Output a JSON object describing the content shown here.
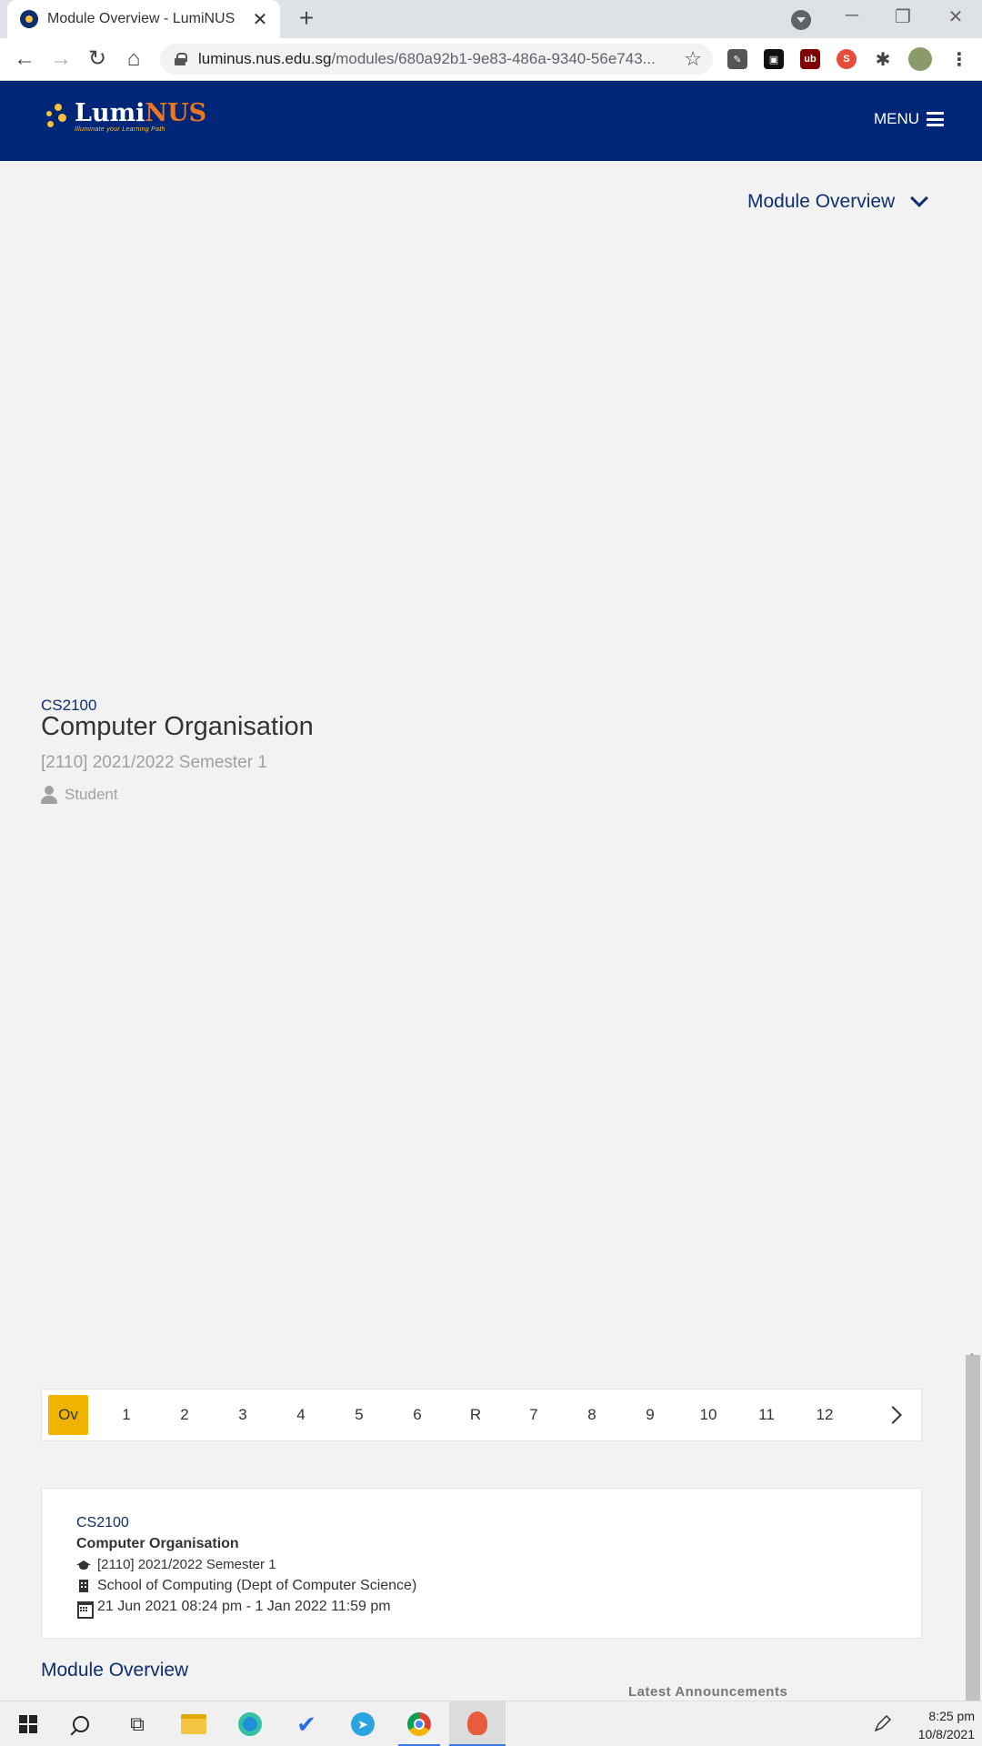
{
  "browser": {
    "tab_title": "Module Overview - LumiNUS",
    "url_domain": "luminus.nus.edu.sg",
    "url_path": "/modules/680a92b1-9e83-486a-9340-56e743..."
  },
  "header": {
    "logo_lumi": "Lumi",
    "logo_nus": "NUS",
    "logo_tagline": "Illuminate your Learning Path",
    "menu_label": "MENU"
  },
  "page": {
    "selector_label": "Module Overview"
  },
  "module": {
    "code": "CS2100",
    "title": "Computer Organisation",
    "semester": "[2110] 2021/2022 Semester 1",
    "role": "Student"
  },
  "weeks": [
    "Ov",
    "1",
    "2",
    "3",
    "4",
    "5",
    "6",
    "R",
    "7",
    "8",
    "9",
    "10",
    "11",
    "12"
  ],
  "active_week": "Ov",
  "card": {
    "code": "CS2100",
    "title": "Computer Organisation",
    "semester": "[2110] 2021/2022 Semester 1",
    "faculty": "School of Computing (Dept of Computer Science)",
    "period": "21 Jun 2021 08:24 pm - 1 Jan 2022 11:59 pm"
  },
  "sections": {
    "overview_title": "Module Overview",
    "latest_announcements": "Latest Announcements"
  },
  "taskbar": {
    "time": "8:25 pm",
    "date": "10/8/2021"
  },
  "colors": {
    "brand_navy": "#002677",
    "brand_orange": "#e87722",
    "accent_yellow": "#f0b400"
  }
}
